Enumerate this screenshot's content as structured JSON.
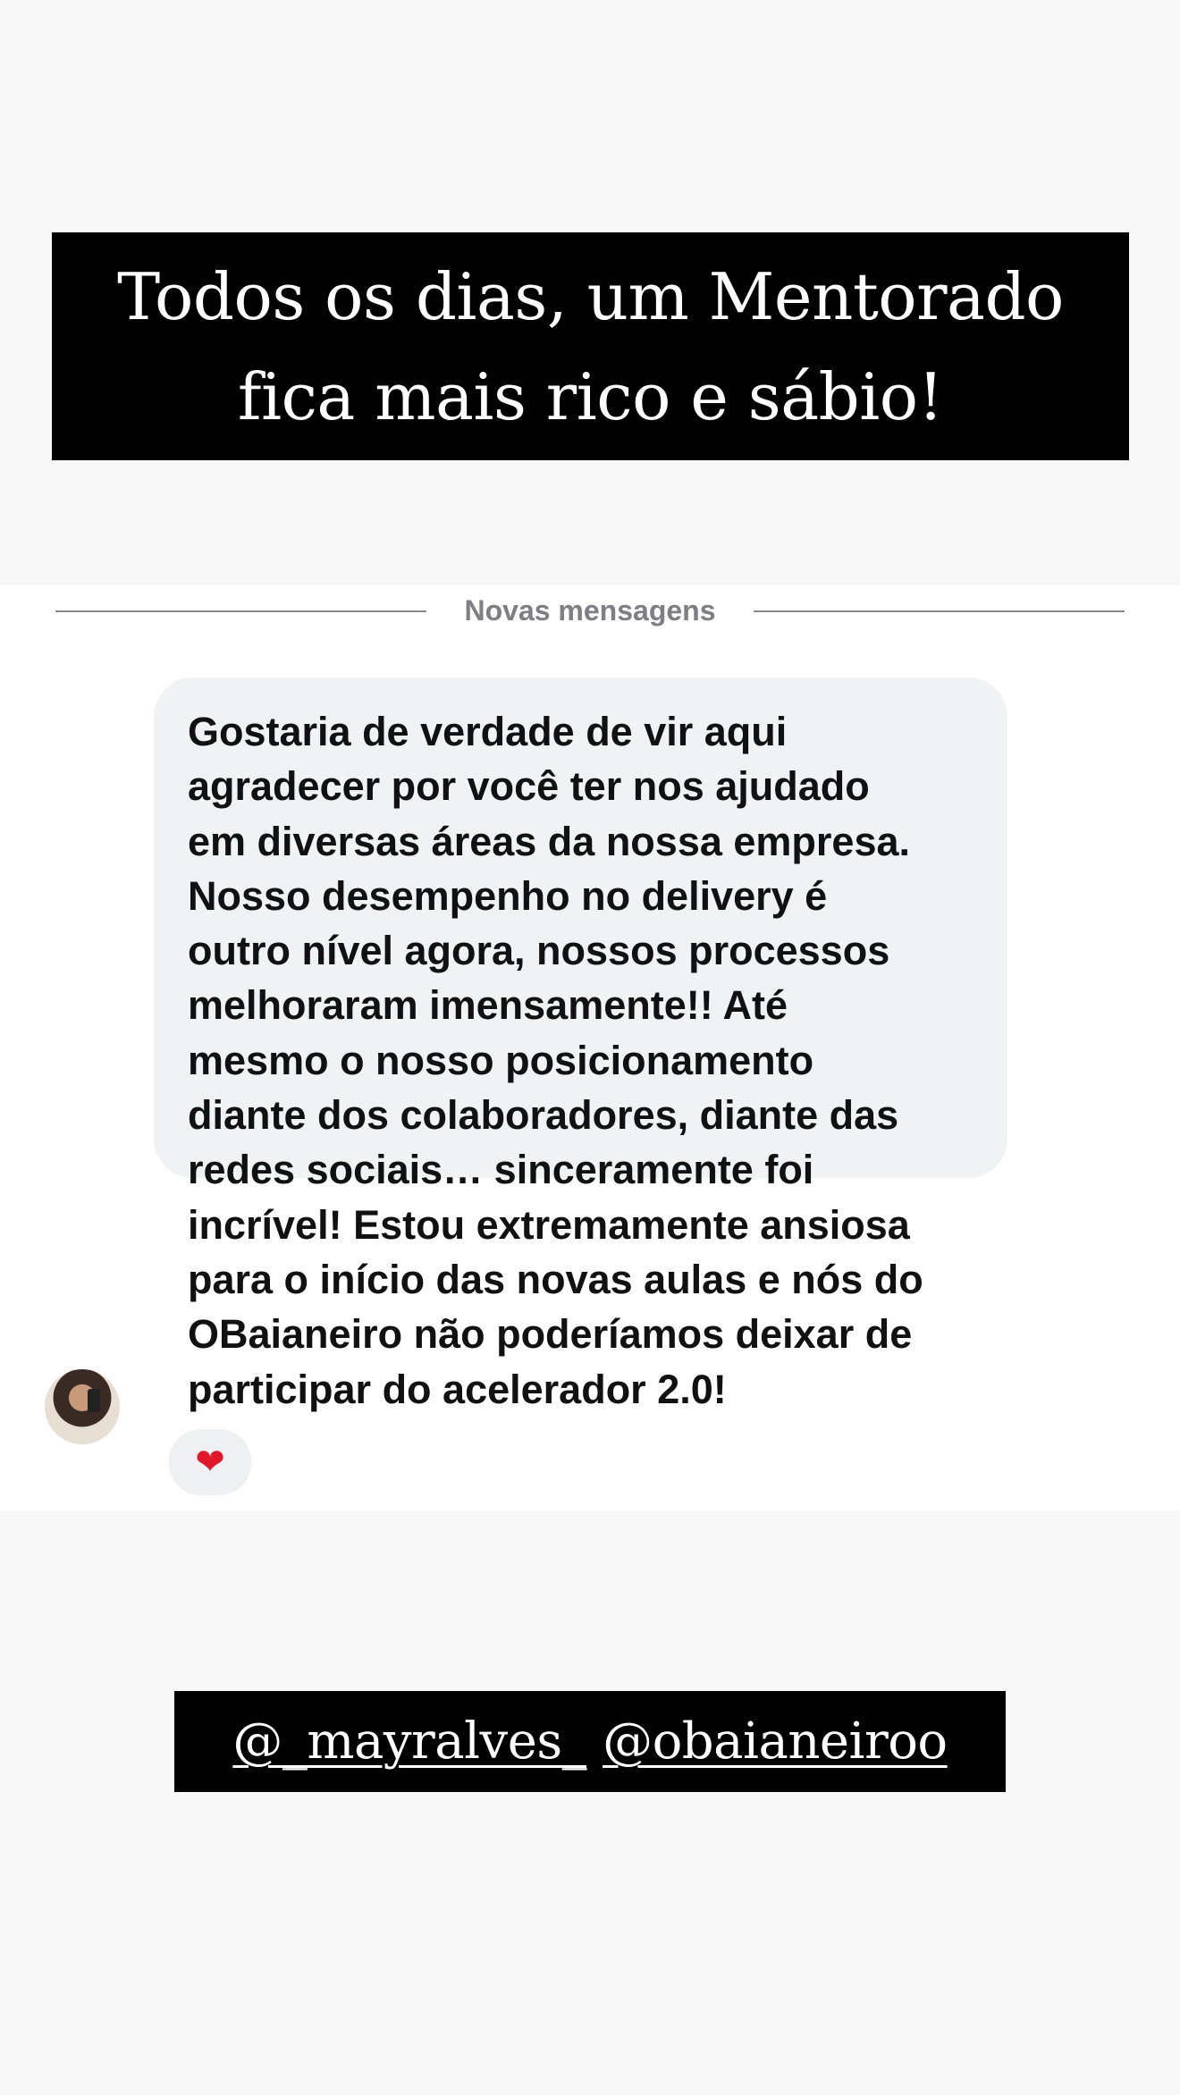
{
  "story": {
    "headline": "Todos os dias, um Mentorado\nfica mais rico e sábio!",
    "mentions": [
      "@_mayralves_",
      "@obaianeiroo"
    ]
  },
  "chat": {
    "divider_label": "Novas mensagens",
    "message": {
      "text": "Gostaria de verdade de vir aqui\nagradecer por você ter nos ajudado\nem diversas áreas da nossa empresa.\nNosso desempenho no delivery é\noutro nível agora, nossos processos\nmelhoraram imensamente!! Até\nmesmo o nosso posicionamento\ndiante dos colaboradores, diante das\nredes sociais… sinceramente foi\nincrível! Estou extremamente ansiosa\npara o início das novas aulas e nós do\nOBaianeiro não poderíamos deixar de\nparticipar do acelerador 2.0!",
      "reaction": "❤"
    },
    "avatar_icon": "user-avatar-icon"
  },
  "colors": {
    "page_background": "#f8f8f8",
    "chat_background": "#ffffff",
    "bubble_background": "#f1f2f4",
    "label_box": "#000000",
    "reaction_heart": "#e0182c"
  }
}
